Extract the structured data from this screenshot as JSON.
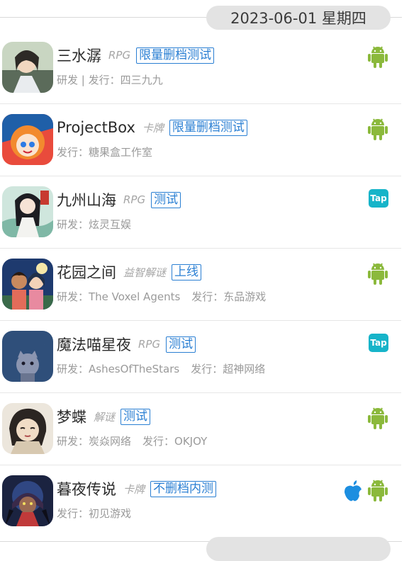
{
  "date_header": {
    "label": "2023-06-01 星期四"
  },
  "colors": {
    "android": "#8bb93c",
    "taptap": "#17b4c9",
    "apple": "#1c8ee0",
    "badge": "#2a7fd3"
  },
  "games": [
    {
      "name": "三水潺",
      "genre": "RPG",
      "status": "限量删档测试",
      "meta": [
        "研发 | 发行：四三九九"
      ],
      "platforms": [
        "android"
      ]
    },
    {
      "name": "ProjectBox",
      "genre": "卡牌",
      "status": "限量删档测试",
      "meta": [
        "发行：糖果盒工作室"
      ],
      "platforms": [
        "android"
      ]
    },
    {
      "name": "九州山海",
      "genre": "RPG",
      "status": "测试",
      "meta": [
        "研发：炫灵互娱"
      ],
      "platforms": [
        "taptap"
      ]
    },
    {
      "name": "花园之间",
      "genre": "益智解谜",
      "status": "上线",
      "meta": [
        "研发：The Voxel Agents",
        "发行：东品游戏"
      ],
      "platforms": [
        "android"
      ]
    },
    {
      "name": "魔法喵星夜",
      "genre": "RPG",
      "status": "测试",
      "meta": [
        "研发：AshesOfTheStars",
        "发行：超神网络"
      ],
      "platforms": [
        "taptap"
      ]
    },
    {
      "name": "梦蝶",
      "genre": "解谜",
      "status": "测试",
      "meta": [
        "研发：炭焱网络",
        "发行：OKJOY"
      ],
      "platforms": [
        "android"
      ]
    },
    {
      "name": "暮夜传说",
      "genre": "卡牌",
      "status": "不删档内测",
      "meta": [
        "发行：初见游戏"
      ],
      "platforms": [
        "apple",
        "android"
      ]
    }
  ],
  "platform_labels": {
    "taptap": "Tap"
  }
}
